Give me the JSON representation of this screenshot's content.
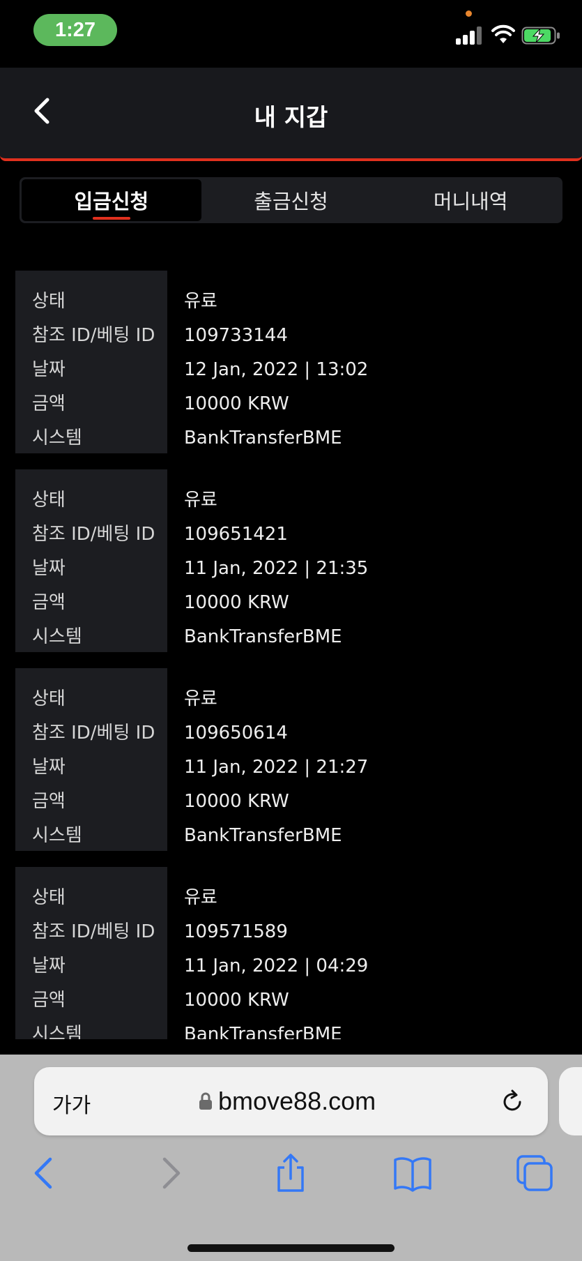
{
  "status_bar": {
    "time": "1:27"
  },
  "header": {
    "title": "내 지갑"
  },
  "tabs": [
    {
      "label": "입금신청",
      "active": true
    },
    {
      "label": "출금신청",
      "active": false
    },
    {
      "label": "머니내역",
      "active": false
    }
  ],
  "field_labels": {
    "status": "상태",
    "ref_id": "참조 ID/베팅 ID",
    "date": "날짜",
    "amount": "금액",
    "system": "시스템"
  },
  "records": [
    {
      "status": "유료",
      "ref_id": "109733144",
      "date": "12 Jan, 2022 | 13:02",
      "amount": "10000 KRW",
      "system": "BankTransferBME"
    },
    {
      "status": "유료",
      "ref_id": "109651421",
      "date": "11 Jan, 2022 | 21:35",
      "amount": "10000 KRW",
      "system": "BankTransferBME"
    },
    {
      "status": "유료",
      "ref_id": "109650614",
      "date": "11 Jan, 2022 | 21:27",
      "amount": "10000 KRW",
      "system": "BankTransferBME"
    },
    {
      "status": "유료",
      "ref_id": "109571589",
      "date": "11 Jan, 2022 | 04:29",
      "amount": "10000 KRW",
      "system": "BankTransferBME"
    }
  ],
  "browser": {
    "text_size_label": "가가",
    "url": "bmove88.com"
  },
  "colors": {
    "accent": "#e0301e",
    "time_pill": "#5cb85c",
    "panel": "#1c1d21",
    "safari_blue": "#3478f6"
  },
  "icons": {
    "back": "chevron-left-icon",
    "lock": "lock-icon",
    "reload": "reload-icon",
    "share": "share-icon",
    "bookmarks": "book-icon",
    "tabs": "tabs-icon"
  }
}
